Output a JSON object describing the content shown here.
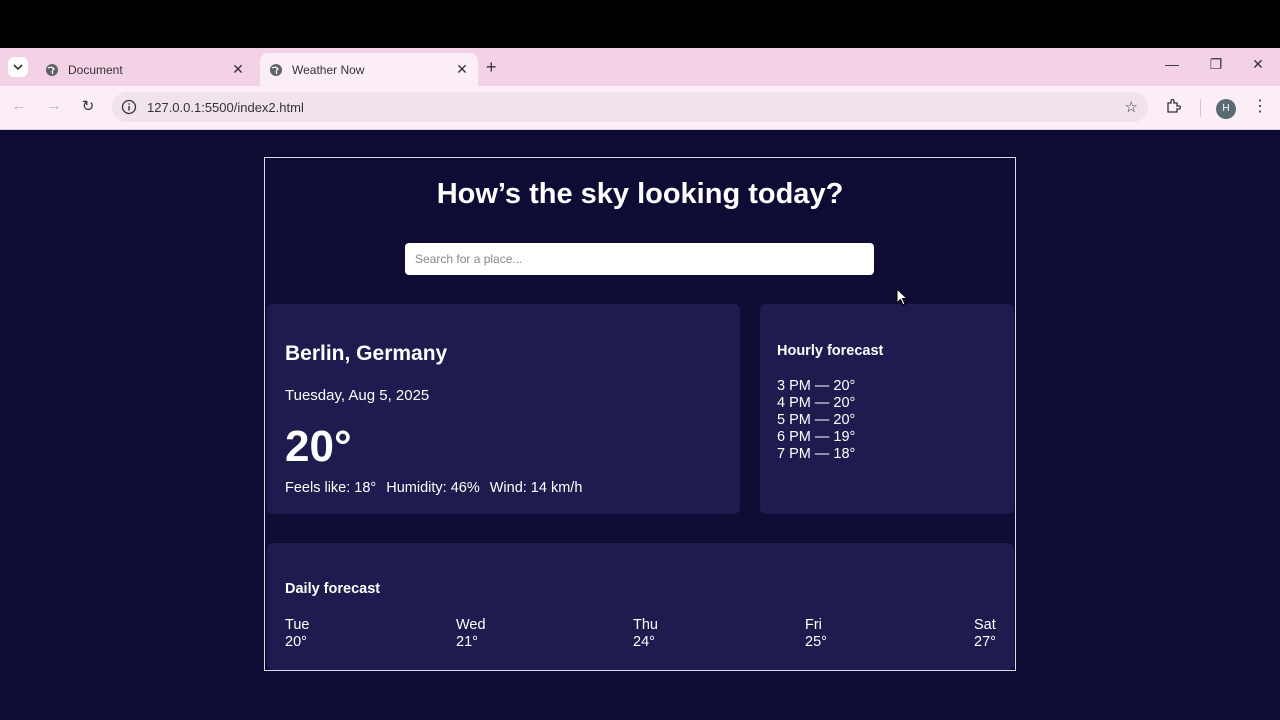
{
  "browser": {
    "tabs": [
      {
        "title": "Document"
      },
      {
        "title": "Weather Now"
      }
    ],
    "url": "127.0.0.1:5500/index2.html",
    "profile_initial": "H"
  },
  "page": {
    "headline": "How’s the sky looking today?",
    "search_placeholder": "Search for a place...",
    "current": {
      "location": "Berlin, Germany",
      "date": "Tuesday, Aug 5, 2025",
      "temperature": "20°",
      "feels_like": "Feels like: 18°",
      "humidity": "Humidity: 46%",
      "wind": "Wind: 14 km/h"
    },
    "hourly": {
      "title": "Hourly forecast",
      "items": [
        "3 PM — 20°",
        "4 PM — 20°",
        "5 PM — 20°",
        "6 PM — 19°",
        "7 PM — 18°"
      ]
    },
    "daily": {
      "title": "Daily forecast",
      "days": [
        {
          "day": "Tue",
          "temp": "20°"
        },
        {
          "day": "Wed",
          "temp": "21°"
        },
        {
          "day": "Thu",
          "temp": "24°"
        },
        {
          "day": "Fri",
          "temp": "25°"
        },
        {
          "day": "Sat",
          "temp": "27°"
        }
      ]
    }
  },
  "colors": {
    "page_bg": "#0e0b35",
    "card_bg": "#1e1c4e",
    "tabstrip_bg": "#f4d2e6"
  }
}
